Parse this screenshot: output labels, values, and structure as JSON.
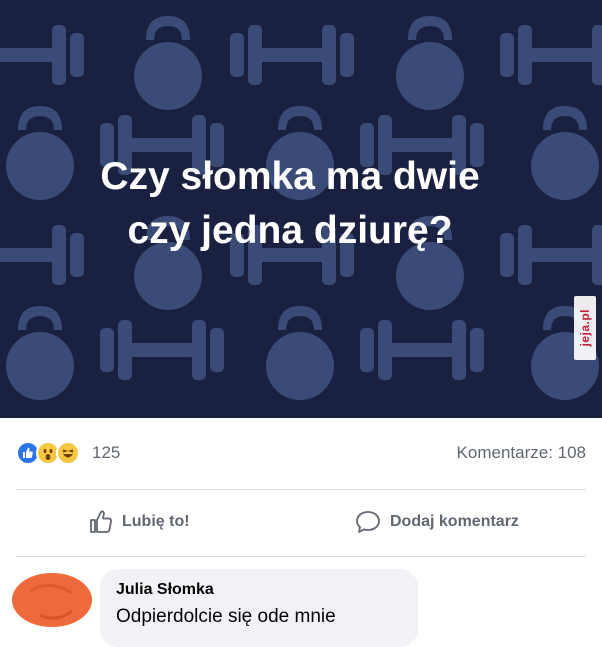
{
  "post": {
    "question_line1": "Czy słomka ma dwie",
    "question_line2": "czy jedna dziurę?",
    "banner_color": "#1a2140",
    "pattern_color": "#3b4b78",
    "banner_icons": [
      "dumbbell-icon",
      "kettlebell-icon"
    ]
  },
  "watermark": {
    "text": "jeja.pl",
    "color": "#c8203c"
  },
  "reactions": {
    "icons": [
      "like-reaction-icon",
      "wow-reaction-icon",
      "haha-reaction-icon"
    ],
    "count": "125",
    "comments_label": "Komentarze: 108"
  },
  "actions": {
    "like_label": "Lubię to!",
    "comment_label": "Dodaj komentarz"
  },
  "comment": {
    "author": "Julia Słomka",
    "text": "Odpierdolcie się ode mnie",
    "avatar_color": "#ef6a3a"
  }
}
